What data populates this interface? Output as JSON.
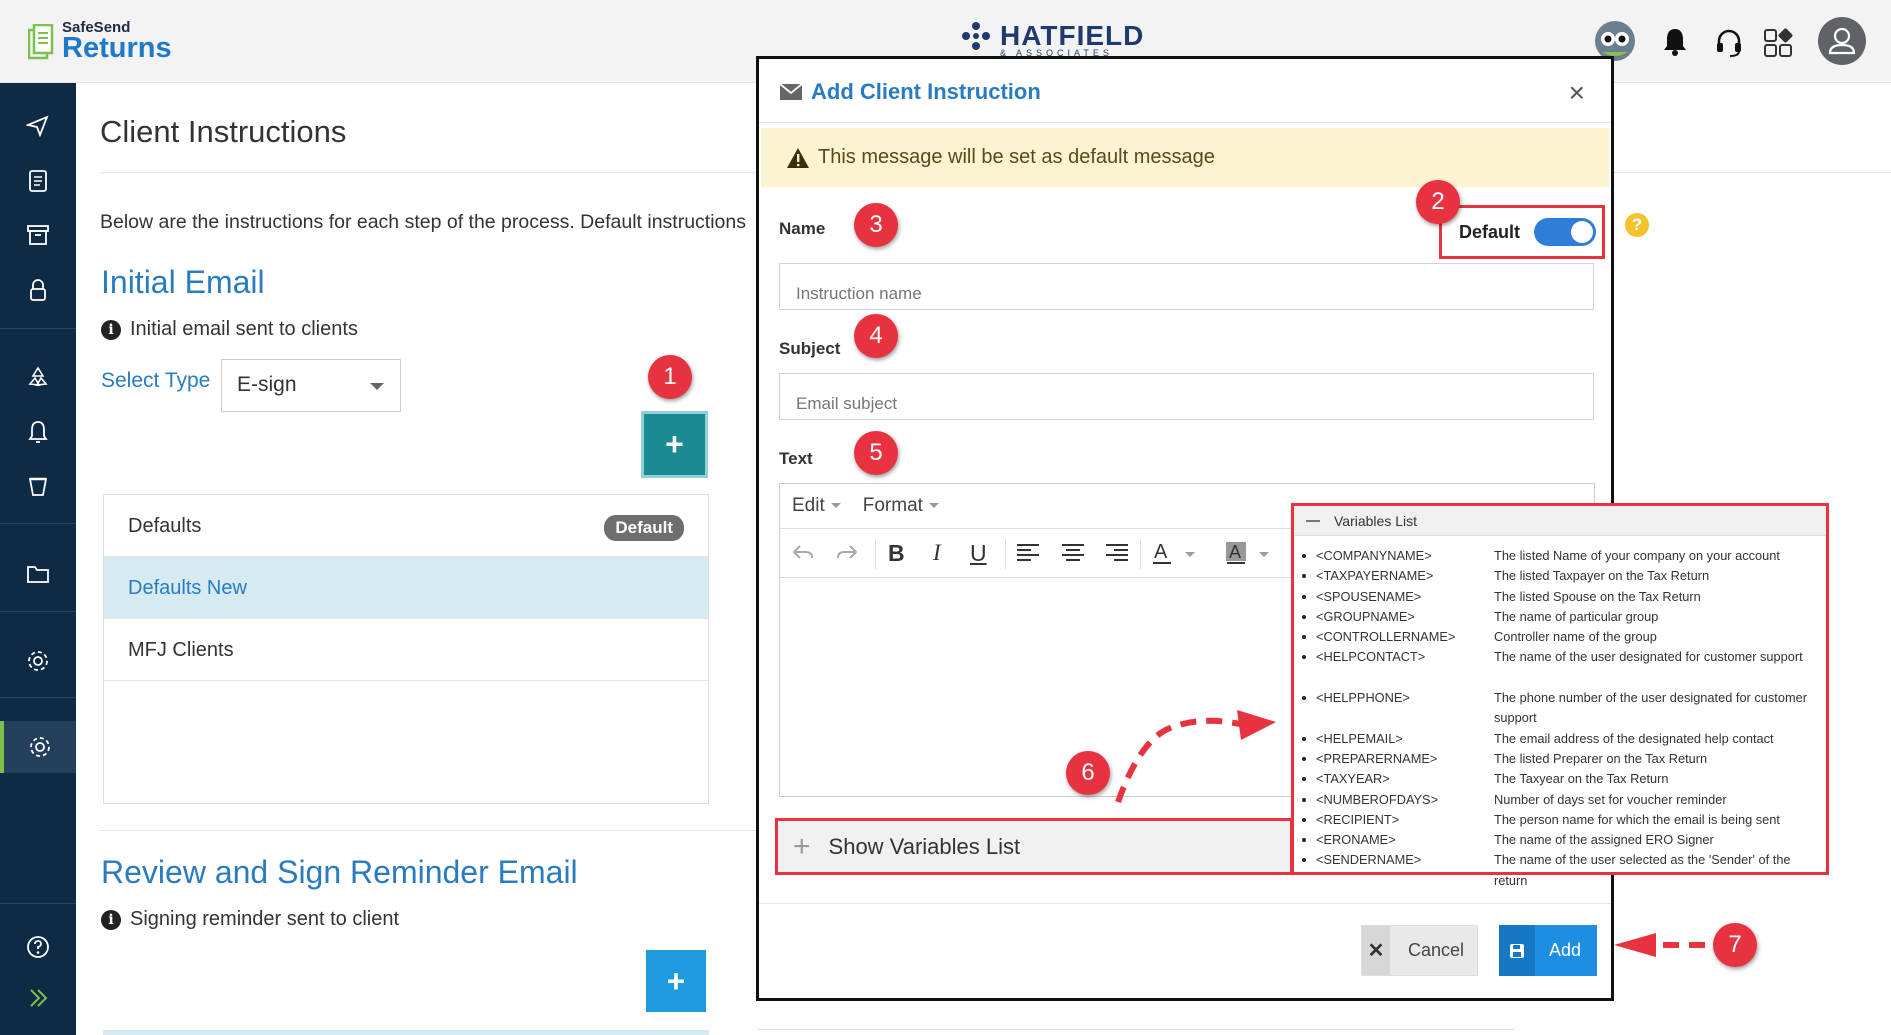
{
  "header": {
    "brand_small": "SafeSend",
    "brand_big": "Returns",
    "company_name": "HATFIELD",
    "company_sub": "& ASSOCIATES"
  },
  "page": {
    "title": "Client Instructions",
    "description": "Below are the instructions for each step of the process. Default instructions",
    "initial_email": {
      "title": "Initial Email",
      "subtitle": "Initial email sent to clients",
      "select_label": "Select Type",
      "select_value": "E-sign",
      "add_label": "+",
      "items": [
        {
          "label": "Defaults",
          "badge": "Default"
        },
        {
          "label": "Defaults New",
          "badge": ""
        },
        {
          "label": "MFJ Clients",
          "badge": ""
        }
      ]
    },
    "reminder_email": {
      "title": "Review and Sign Reminder Email",
      "subtitle": "Signing reminder sent to client",
      "add_label": "+"
    }
  },
  "modal": {
    "title": "Add Client Instruction",
    "close": "×",
    "alert": "This message will be set as default message",
    "name_label": "Name",
    "name_placeholder": "Instruction name",
    "default_label": "Default",
    "default_on": true,
    "help": "?",
    "subject_label": "Subject",
    "subject_placeholder": "Email subject",
    "text_label": "Text",
    "editor_menu": [
      "Edit",
      "Format"
    ],
    "show_variables": "Show Variables List",
    "cancel": "Cancel",
    "add": "Add"
  },
  "variables": {
    "title": "Variables List",
    "items": [
      {
        "name": "<COMPANYNAME>",
        "desc": "The listed Name of your company on your account"
      },
      {
        "name": "<TAXPAYERNAME>",
        "desc": "The listed Taxpayer on the Tax Return"
      },
      {
        "name": "<SPOUSENAME>",
        "desc": "The listed Spouse on the Tax Return"
      },
      {
        "name": "<GROUPNAME>",
        "desc": "The name of particular group"
      },
      {
        "name": "<CONTROLLERNAME>",
        "desc": "Controller name of the group"
      },
      {
        "name": "<HELPCONTACT>",
        "desc": "The name of the user designated for customer support"
      },
      {
        "name": "<HELPPHONE>",
        "desc": "The phone number of the user designated for customer support"
      },
      {
        "name": "<HELPEMAIL>",
        "desc": "The email address of the designated help contact"
      },
      {
        "name": "<PREPARERNAME>",
        "desc": "The listed Preparer on the Tax Return"
      },
      {
        "name": "<TAXYEAR>",
        "desc": "The Taxyear on the Tax Return"
      },
      {
        "name": "<NUMBEROFDAYS>",
        "desc": "Number of days set for voucher reminder"
      },
      {
        "name": "<RECIPIENT>",
        "desc": "The person name for which the email is being sent"
      },
      {
        "name": "<ERONAME>",
        "desc": "The name of the assigned ERO Signer"
      },
      {
        "name": "<SENDERNAME>",
        "desc": "The name of the user selected as the 'Sender' of the return"
      }
    ]
  },
  "markers": [
    "1",
    "2",
    "3",
    "4",
    "5",
    "6",
    "7"
  ],
  "colors": {
    "sidebar": "#0e2a45",
    "accent": "#2a7bc0",
    "teal": "#1b8a94",
    "marker": "#e8323f",
    "toggle": "#2f7fd8"
  }
}
